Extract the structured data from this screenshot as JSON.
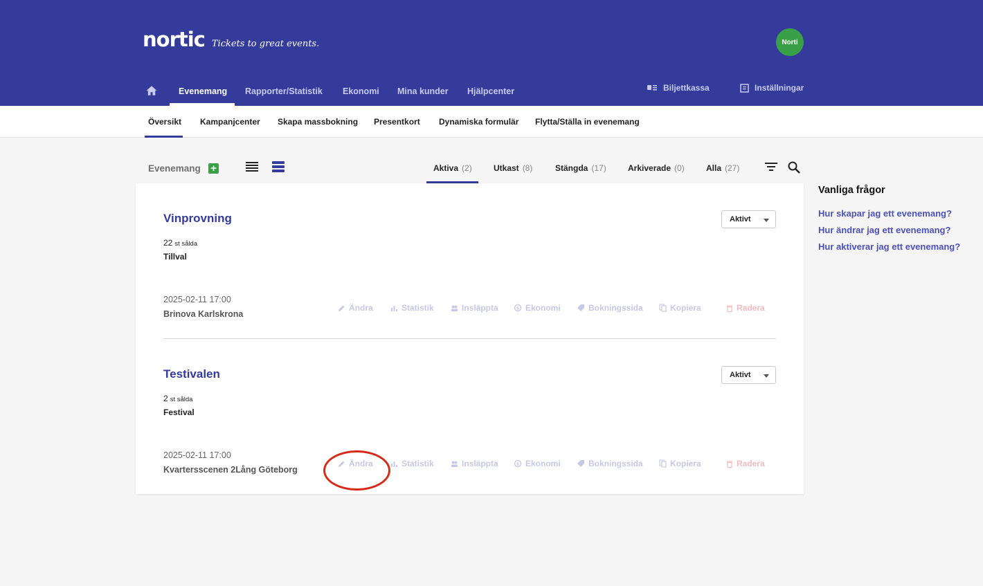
{
  "header": {
    "logo": "nortic",
    "tagline": "Tickets to great events.",
    "avatar_initials": "Norti",
    "nav": [
      "Evenemang",
      "Rapporter/Statistik",
      "Ekonomi",
      "Mina kunder",
      "Hjälpcenter"
    ],
    "active_nav": "Evenemang",
    "box_office_label": "Biljettkassa",
    "settings_label": "Inställningar"
  },
  "subnav": {
    "items": [
      "Översikt",
      "Kampanjcenter",
      "Skapa massbokning",
      "Presentkort",
      "Dynamiska formulär",
      "Flytta/Ställa in evenemang"
    ],
    "active": "Översikt"
  },
  "toolbar": {
    "label": "Evenemang",
    "filters": [
      {
        "label": "Aktiva",
        "count": "(2)"
      },
      {
        "label": "Utkast",
        "count": "(8)"
      },
      {
        "label": "Stängda",
        "count": "(17)"
      },
      {
        "label": "Arkiverade",
        "count": "(0)"
      },
      {
        "label": "Alla",
        "count": "(27)"
      }
    ],
    "active_filter": "Aktiva"
  },
  "actions": [
    "Ändra",
    "Statistik",
    "Insläppta",
    "Ekonomi",
    "Bokningssida",
    "Kopiera",
    "Radera"
  ],
  "events": [
    {
      "title": "Vinprovning",
      "sold": "22",
      "sold_unit": "st sålda",
      "category": "Tillval",
      "date": "2025-02-11 17:00",
      "venue": "Brinova Karlskrona",
      "status": "Aktivt"
    },
    {
      "title": "Testivalen",
      "sold": "2",
      "sold_unit": "st sålda",
      "category": "Festival",
      "date": "2025-02-11 17:00",
      "venue": "Kvartersscenen 2Lång Göteborg",
      "status": "Aktivt"
    }
  ],
  "faq": {
    "title": "Vanliga frågor",
    "links": [
      "Hur skapar jag ett evenemang?",
      "Hur ändrar jag ett evenemang?",
      "Hur aktiverar jag ett evenemang?"
    ]
  },
  "colors": {
    "brand": "#343b9b",
    "accent_green": "#3aa048",
    "danger": "#f2bcbc",
    "annotation": "#d52a1a"
  }
}
